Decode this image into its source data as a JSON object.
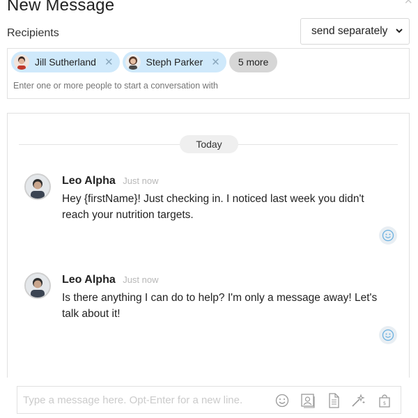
{
  "header": {
    "title": "New Message"
  },
  "recipients": {
    "label": "Recipients",
    "send_mode": "send separately",
    "chips": [
      {
        "name": "Jill Sutherland"
      },
      {
        "name": "Steph Parker"
      }
    ],
    "more": "5 more",
    "placeholder": "Enter one or more people to start a conversation with"
  },
  "thread": {
    "day_label": "Today",
    "messages": [
      {
        "sender": "Leo Alpha",
        "time": "Just now",
        "text": "Hey {firstName}! Just checking in. I noticed last week you didn't reach your nutrition targets."
      },
      {
        "sender": "Leo Alpha",
        "time": "Just now",
        "text": "Is there anything I can do to help? I'm only a message away! Let's talk about it!"
      }
    ]
  },
  "compose": {
    "placeholder": "Type a message here. Opt-Enter for a new line."
  },
  "icons": {
    "close": "close-icon",
    "dropdown": "chevron-down-icon",
    "chip_remove": "close-icon",
    "reaction": "smiley-icon",
    "toolbar": [
      "smiley-icon",
      "contact-card-icon",
      "document-icon",
      "magic-wand-icon",
      "shopping-bag-icon"
    ]
  },
  "colors": {
    "chip_bg": "#cfe9fb",
    "more_chip_bg": "#d6d6d6",
    "reaction_bg": "#e8eef3"
  }
}
